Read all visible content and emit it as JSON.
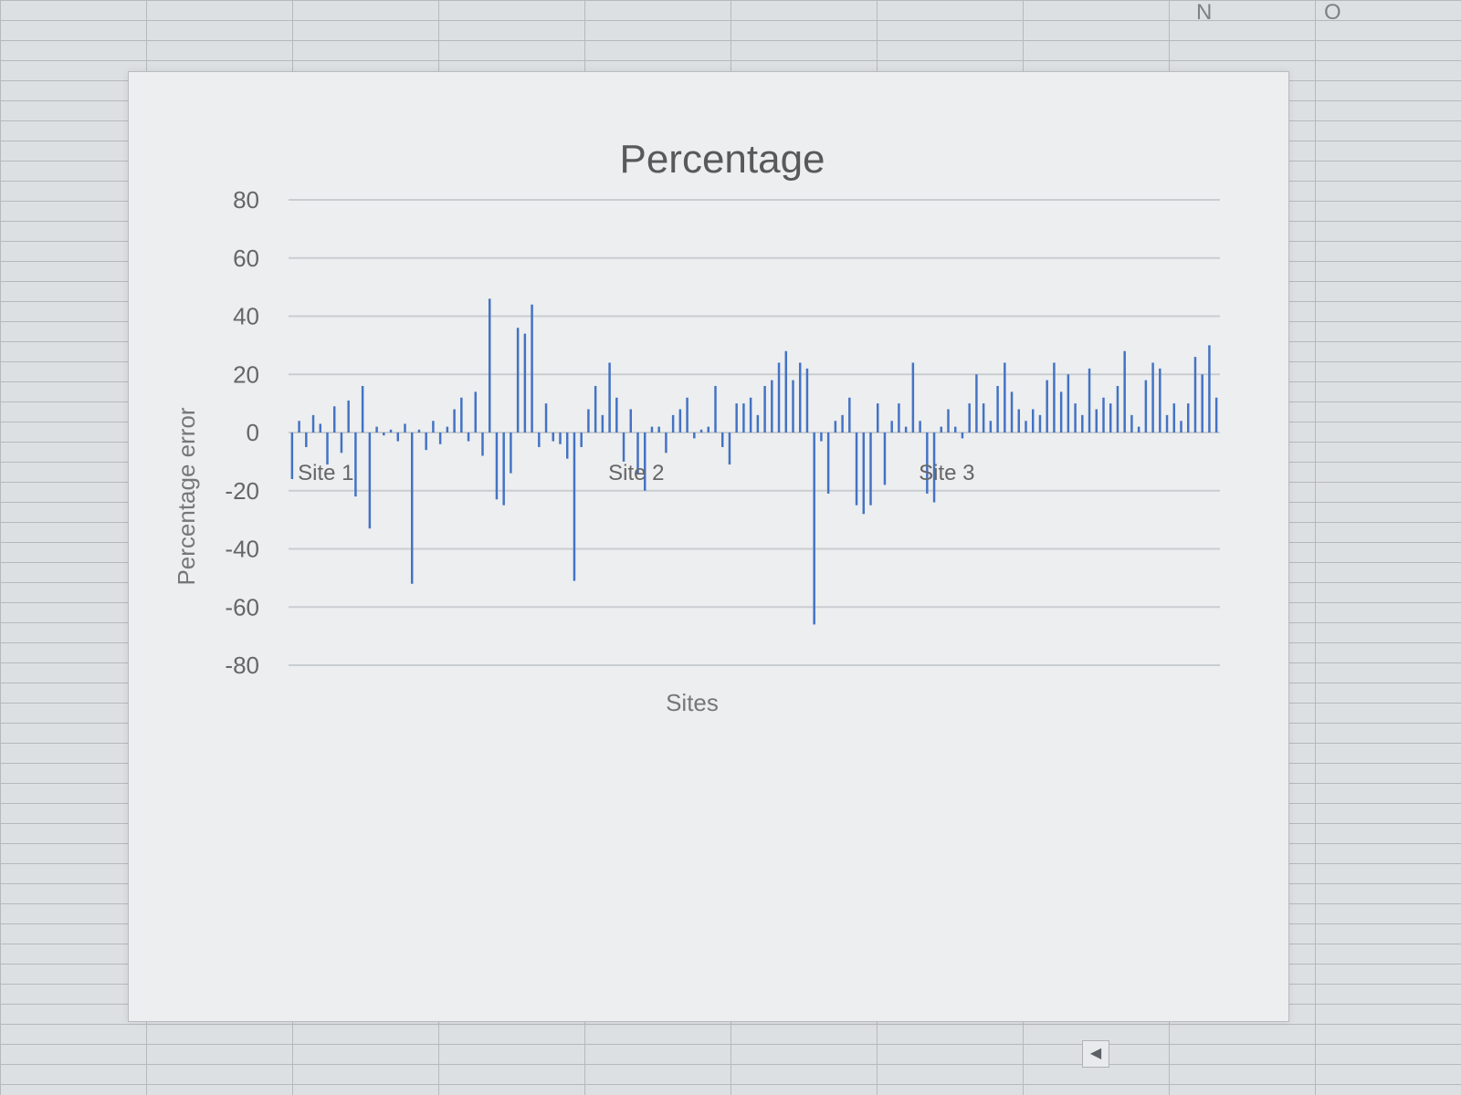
{
  "column_headers": [
    "N",
    "O"
  ],
  "chart_data": {
    "type": "bar",
    "title": "Percentage",
    "xlabel": "Sites",
    "ylabel": "Percentage error",
    "ylim": [
      -80,
      80
    ],
    "yticks": [
      80,
      60,
      40,
      20,
      0,
      -20,
      -40,
      -60,
      -80
    ],
    "grid": true,
    "legend": "none",
    "bar_color": "#4472c4",
    "categories": [
      "Site 1",
      "Site 2",
      "Site 3"
    ],
    "series": [
      {
        "values": [
          -16,
          4,
          -5,
          6,
          3,
          -11,
          9,
          -7,
          11,
          -22,
          16,
          -33,
          2,
          -1,
          1,
          -3,
          3,
          -52,
          1,
          -6,
          4,
          -4,
          2,
          8,
          12,
          -3,
          14,
          -8,
          46,
          -23,
          -25,
          -14,
          36,
          34,
          44,
          -5,
          10,
          -3,
          -4,
          -9,
          -51,
          -5,
          8,
          16,
          6,
          24,
          12,
          -10,
          8,
          -14,
          -20,
          2,
          2,
          -7,
          6,
          8,
          12,
          -2,
          1,
          2,
          16,
          -5,
          -11,
          10,
          10,
          12,
          6,
          16,
          18,
          24,
          28,
          18,
          24,
          22,
          -66,
          -3,
          -21,
          4,
          6,
          12,
          -25,
          -28,
          -25,
          10,
          -18,
          4,
          10,
          2,
          24,
          4,
          -21,
          -24,
          2,
          8,
          2,
          -2,
          10,
          20,
          10,
          4,
          16,
          24,
          14,
          8,
          4,
          8,
          6,
          18,
          24,
          14,
          20,
          10,
          6,
          22,
          8,
          12,
          10,
          16,
          28,
          6,
          2,
          18,
          24,
          22,
          6,
          10,
          4,
          10,
          26,
          20,
          30,
          12
        ]
      }
    ]
  }
}
